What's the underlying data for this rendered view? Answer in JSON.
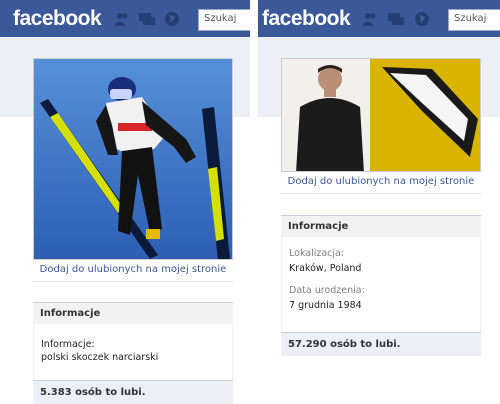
{
  "left": {
    "logo": "facebook",
    "search_placeholder": "Szukaj",
    "photo_icon": "ski-jumper-photo",
    "add_favorite": "Dodaj do ulubionych na mojej stronie",
    "info_title": "Informacje",
    "info_label": "Informacje:",
    "info_value": "polski skoczek narciarski",
    "likes": "5.383 osób to lubi."
  },
  "right": {
    "logo": "facebook",
    "search_placeholder": "Szukaj",
    "photo_icon": "man-portrait-photo",
    "add_favorite": "Dodaj do ulubionych na mojej stronie",
    "info_title": "Informacje",
    "location_label": "Lokalizacja:",
    "location_value": "Kraków, Poland",
    "birth_label": "Data urodzenia:",
    "birth_value": "7 grudnia 1984",
    "likes": "57.290 osób to lubi."
  },
  "icons": [
    "friends-icon",
    "messages-icon",
    "globe-icon"
  ],
  "colors": {
    "brand_blue": "#3b5998",
    "page_grey": "#eceff5"
  }
}
